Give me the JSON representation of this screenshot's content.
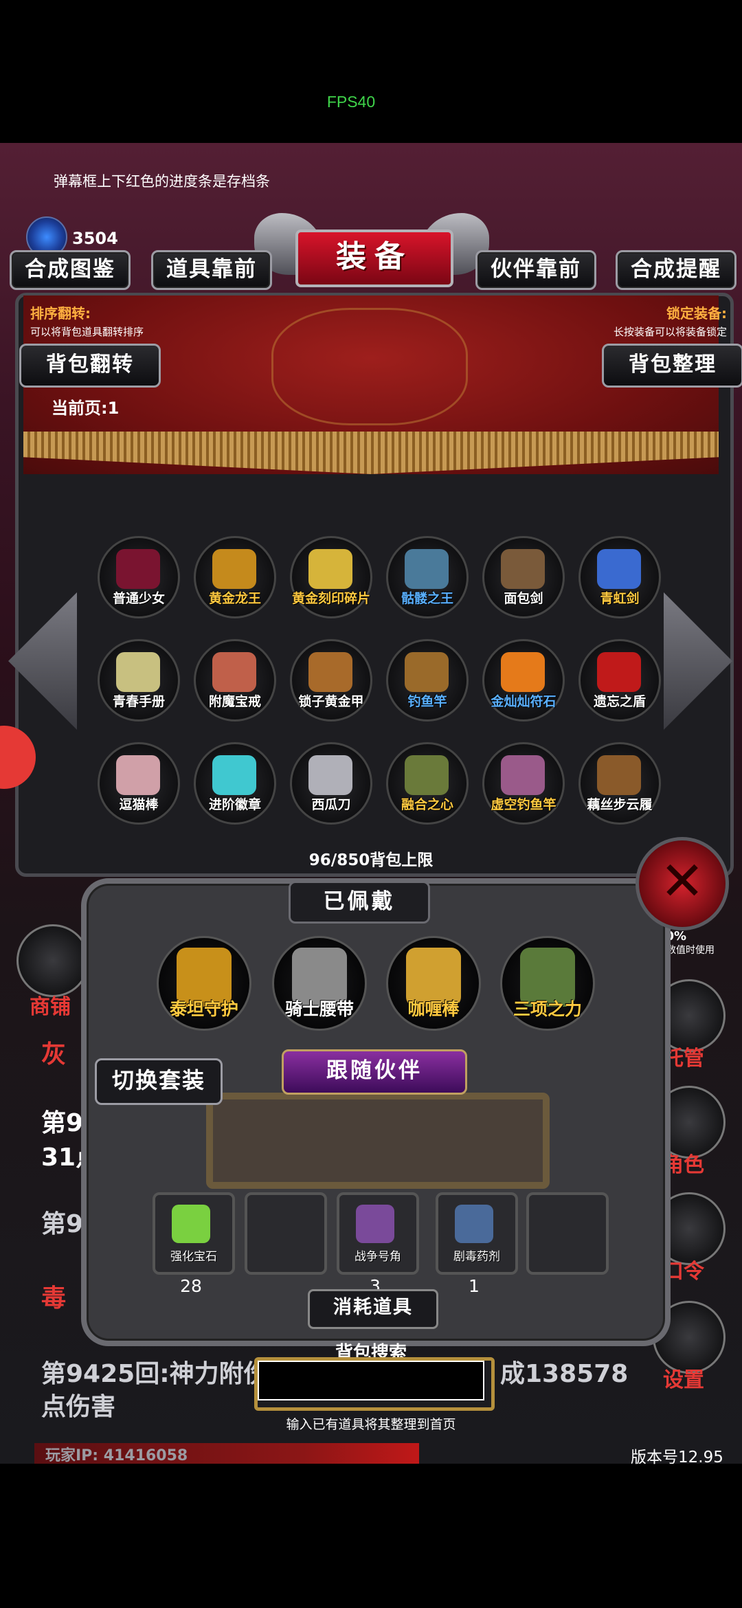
{
  "fps": "FPS40",
  "hint": "弹幕框上下红色的进度条是存档条",
  "currency": {
    "icon": "blue-crystal-icon",
    "amount": "3504"
  },
  "tabs": {
    "compose_book": "合成图鉴",
    "items_front": "道具靠前",
    "title": "装备",
    "partner_front": "伙伴靠前",
    "compose_remind": "合成提醒"
  },
  "sort": {
    "label": "排序翻转:",
    "desc": "可以将背包道具翻转排序",
    "button": "背包翻转"
  },
  "lock": {
    "label": "锁定装备:",
    "desc": "长按装备可以将装备锁定",
    "button": "背包整理"
  },
  "page_label": "当前页:1",
  "items": [
    {
      "name": "普通少女",
      "color": "#ffffff",
      "icon": "girl-icon",
      "tint": "#7a1430"
    },
    {
      "name": "黄金龙王",
      "color": "#ffc940",
      "icon": "golden-dragon-icon",
      "tint": "#c58a1c"
    },
    {
      "name": "黄金刻印碎片",
      "color": "#ffc940",
      "icon": "golden-seal-icon",
      "tint": "#d6b43a"
    },
    {
      "name": "骷髅之王",
      "color": "#5ab0ff",
      "icon": "skeleton-king-icon",
      "tint": "#4a7a9a"
    },
    {
      "name": "面包剑",
      "color": "#ffffff",
      "icon": "sword-icon",
      "tint": "#7a5a3a"
    },
    {
      "name": "青虹剑",
      "color": "#ffc940",
      "icon": "blue-sword-icon",
      "tint": "#3a6ad0"
    },
    {
      "name": "青春手册",
      "color": "#ffffff",
      "icon": "book-icon",
      "tint": "#c8c080"
    },
    {
      "name": "附魔宝戒",
      "color": "#ffffff",
      "icon": "ring-icon",
      "tint": "#c0604a"
    },
    {
      "name": "锁子黄金甲",
      "color": "#ffffff",
      "icon": "armor-icon",
      "tint": "#a86a2a"
    },
    {
      "name": "钓鱼竿",
      "color": "#5ab0ff",
      "icon": "fishing-rod-icon",
      "tint": "#9a6a2a"
    },
    {
      "name": "金灿灿符石",
      "color": "#5ab0ff",
      "icon": "rune-stone-icon",
      "tint": "#e57a1a"
    },
    {
      "name": "遗忘之盾",
      "color": "#ffffff",
      "icon": "shield-icon",
      "tint": "#c01a1a"
    },
    {
      "name": "逗猫棒",
      "color": "#ffffff",
      "icon": "cat-wand-icon",
      "tint": "#d0a0a8"
    },
    {
      "name": "进阶徽章",
      "color": "#ffffff",
      "icon": "badge-icon",
      "tint": "#40c8d0"
    },
    {
      "name": "西瓜刀",
      "color": "#ffffff",
      "icon": "knife-icon",
      "tint": "#b0b0b8"
    },
    {
      "name": "融合之心",
      "color": "#ffc940",
      "icon": "fusion-heart-icon",
      "tint": "#6a7a3a"
    },
    {
      "name": "虚空钓鱼竿",
      "color": "#ffc940",
      "icon": "void-rod-icon",
      "tint": "#9a5a8a"
    },
    {
      "name": "藕丝步云履",
      "color": "#ffffff",
      "icon": "boots-icon",
      "tint": "#8a5a2a"
    }
  ],
  "bag_limit": "96/850背包上限",
  "equipped": {
    "header": "已佩戴",
    "items": [
      {
        "name": "泰坦守护",
        "color": "#ffc940",
        "icon": "titan-armor-icon",
        "tint": "#c8901a"
      },
      {
        "name": "骑士腰带",
        "color": "#ffffff",
        "icon": "belt-icon",
        "tint": "#8a8a8a"
      },
      {
        "name": "咖喱棒",
        "color": "#ffc940",
        "icon": "excalibur-icon",
        "tint": "#d0a030"
      },
      {
        "name": "三项之力",
        "color": "#ffc940",
        "icon": "triforce-icon",
        "tint": "#5a7a3a"
      }
    ]
  },
  "switch_set": "切换套装",
  "follow_partner": "跟随伙伴",
  "consumables": {
    "title": "消耗道具",
    "items": [
      {
        "name": "强化宝石",
        "icon": "gem-icon",
        "tint": "#7ad040",
        "count": "28"
      },
      {
        "name": "",
        "icon": "",
        "tint": "transparent",
        "count": ""
      },
      {
        "name": "战争号角",
        "icon": "war-horn-icon",
        "tint": "#7a4a9a",
        "count": "3"
      },
      {
        "name": "剧毒药剂",
        "icon": "poison-potion-icon",
        "tint": "#4a6a9a",
        "count": "1"
      },
      {
        "name": "",
        "icon": "",
        "tint": "transparent",
        "count": ""
      }
    ]
  },
  "search": {
    "label": "背包搜索",
    "value": "",
    "hint": "输入已有道具将其整理到首页"
  },
  "side_buttons": [
    {
      "label": "商铺",
      "icon": "shop-icon"
    },
    {
      "label": "托管",
      "icon": "dice-icon"
    },
    {
      "label": "角色",
      "icon": "character-icon"
    },
    {
      "label": "口令",
      "icon": "code-book-icon"
    },
    {
      "label": "设置",
      "icon": "gear-icon"
    }
  ],
  "background": {
    "line1": "灰",
    "line2": "第94",
    "line3": "31点",
    "line4": "第94",
    "line5": "毒",
    "line6": "第9425回:神力附伤",
    "line6b": "成138578",
    "line7": "点伤害",
    "hosting_note": "其数值时使用",
    "hosting_pct": "90%"
  },
  "player_ip": "玩家IP:  41416058",
  "version": "版本号12.95"
}
